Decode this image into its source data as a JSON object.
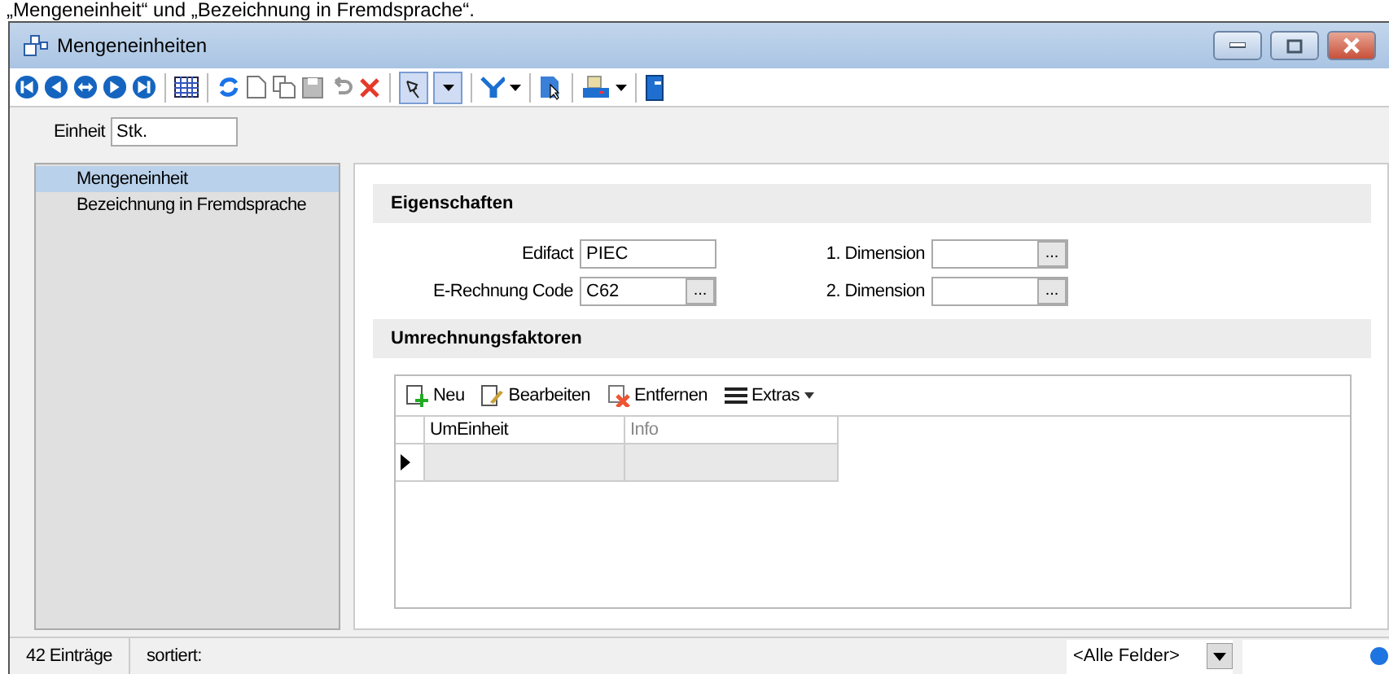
{
  "caption": "„Mengeneinheit“ und „Bezeichnung in Fremdsprache“.",
  "window": {
    "title": "Mengeneinheiten"
  },
  "toolbar": {
    "pin_pressed": true
  },
  "unit_field": {
    "label": "Einheit",
    "value": "Stk."
  },
  "sidebar": {
    "items": [
      {
        "label": "Mengeneinheit",
        "selected": true
      },
      {
        "label": "Bezeichnung in Fremdsprache",
        "selected": false
      }
    ]
  },
  "properties": {
    "title": "Eigenschaften",
    "fields": [
      {
        "label": "Edifact",
        "value": "PIEC",
        "kind": "text"
      },
      {
        "label": "1. Dimension",
        "kind": "lookup",
        "button": "..."
      },
      {
        "label": "E-Rechnung Code",
        "value": "C62",
        "kind": "lookup",
        "button": "..."
      },
      {
        "label": "2. Dimension",
        "kind": "lookup",
        "button": "..."
      }
    ]
  },
  "conversion": {
    "title": "Umrechnungsfaktoren",
    "actions": [
      {
        "label": "Neu",
        "kind": "add"
      },
      {
        "label": "Bearbeiten",
        "kind": "edit"
      },
      {
        "label": "Entfernen",
        "kind": "delete"
      },
      {
        "label": "Extras",
        "kind": "menu"
      }
    ],
    "columns": [
      "UmEinheit",
      "Info"
    ]
  },
  "status_bar": {
    "count": "42 Einträge",
    "sort": "sortiert:",
    "filter": "<Alle Felder>"
  }
}
